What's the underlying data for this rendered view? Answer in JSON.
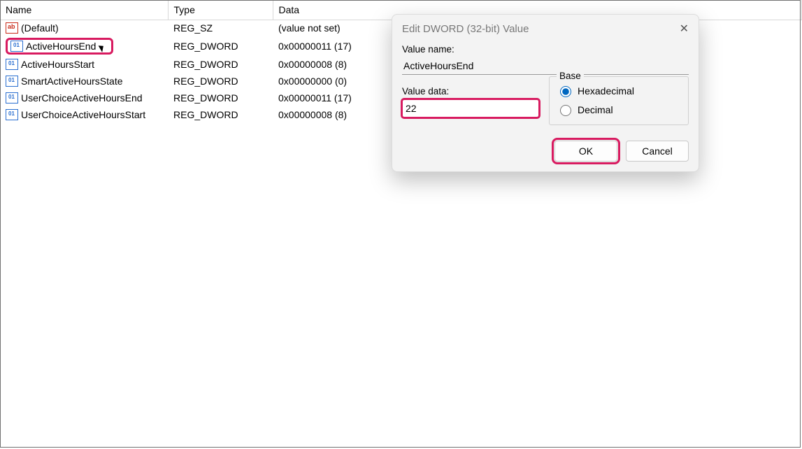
{
  "columns": {
    "name": "Name",
    "type": "Type",
    "data": "Data"
  },
  "rows": [
    {
      "icon": "sz",
      "name": "(Default)",
      "type": "REG_SZ",
      "data": "(value not set)"
    },
    {
      "icon": "dw",
      "name": "ActiveHoursEnd",
      "type": "REG_DWORD",
      "data": "0x00000011 (17)",
      "highlighted": true
    },
    {
      "icon": "dw",
      "name": "ActiveHoursStart",
      "type": "REG_DWORD",
      "data": "0x00000008 (8)"
    },
    {
      "icon": "dw",
      "name": "SmartActiveHoursState",
      "type": "REG_DWORD",
      "data": "0x00000000 (0)"
    },
    {
      "icon": "dw",
      "name": "UserChoiceActiveHoursEnd",
      "type": "REG_DWORD",
      "data": "0x00000011 (17)"
    },
    {
      "icon": "dw",
      "name": "UserChoiceActiveHoursStart",
      "type": "REG_DWORD",
      "data": "0x00000008 (8)"
    }
  ],
  "dialog": {
    "title": "Edit DWORD (32-bit) Value",
    "value_name_label": "Value name:",
    "value_name": "ActiveHoursEnd",
    "value_data_label": "Value data:",
    "value_data": "22",
    "base_label": "Base",
    "hex_label": "Hexadecimal",
    "dec_label": "Decimal",
    "base_selected": "hex",
    "ok": "OK",
    "cancel": "Cancel"
  }
}
